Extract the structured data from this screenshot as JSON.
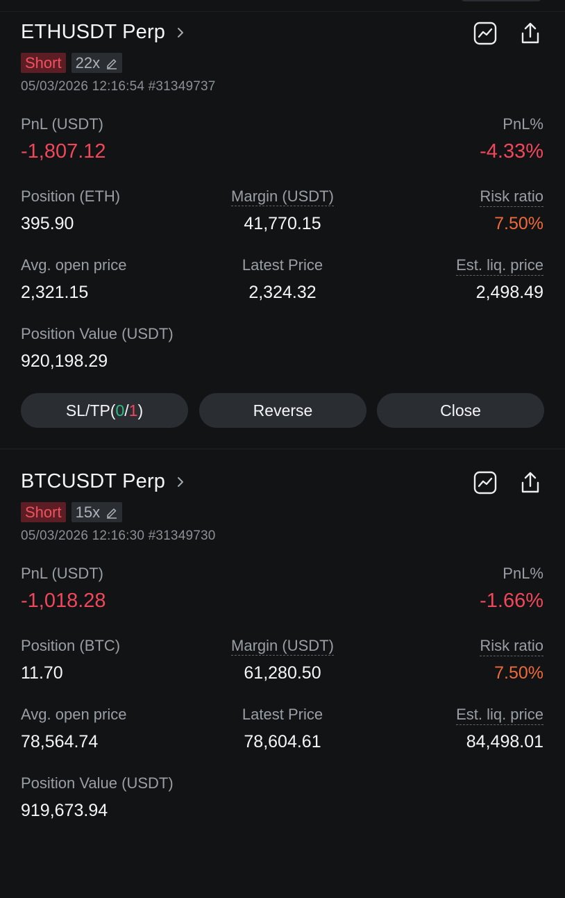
{
  "positions": [
    {
      "symbol": "ETHUSDT Perp",
      "side": "Short",
      "leverage": "22x",
      "opened": "05/03/2026 12:16:54",
      "order_id": "#31349737",
      "pnl_label": "PnL (USDT)",
      "pnl_value": "-1,807.12",
      "pnl_pct_label": "PnL%",
      "pnl_pct_value": "-4.33%",
      "position_label": "Position (ETH)",
      "position_value": "395.90",
      "margin_label": "Margin (USDT)",
      "margin_value": "41,770.15",
      "risk_label": "Risk ratio",
      "risk_value": "7.50%",
      "avg_open_label": "Avg. open price",
      "avg_open_value": "2,321.15",
      "latest_label": "Latest Price",
      "latest_value": "2,324.32",
      "liq_label": "Est. liq. price",
      "liq_value": "2,498.49",
      "pos_value_label": "Position Value (USDT)",
      "pos_value_value": "920,198.29",
      "sltp_prefix": "SL/TP(",
      "sltp_sl": "0",
      "sltp_sep": "/",
      "sltp_tp": "1",
      "sltp_suffix": ")",
      "reverse_label": "Reverse",
      "close_label": "Close"
    },
    {
      "symbol": "BTCUSDT Perp",
      "side": "Short",
      "leverage": "15x",
      "opened": "05/03/2026 12:16:30",
      "order_id": "#31349730",
      "pnl_label": "PnL (USDT)",
      "pnl_value": "-1,018.28",
      "pnl_pct_label": "PnL%",
      "pnl_pct_value": "-1.66%",
      "position_label": "Position (BTC)",
      "position_value": "11.70",
      "margin_label": "Margin (USDT)",
      "margin_value": "61,280.50",
      "risk_label": "Risk ratio",
      "risk_value": "7.50%",
      "avg_open_label": "Avg. open price",
      "avg_open_value": "78,564.74",
      "latest_label": "Latest Price",
      "latest_value": "78,604.61",
      "liq_label": "Est. liq. price",
      "liq_value": "84,498.01",
      "pos_value_label": "Position Value (USDT)",
      "pos_value_value": "919,673.94"
    }
  ],
  "icons": {
    "chevron": "chevron-right-icon",
    "chart": "line-chart-icon",
    "share": "share-icon",
    "edit": "pencil-icon"
  },
  "colors": {
    "background": "#121315",
    "loss_red": "#f0475a",
    "short_tag_bg": "#5c1e24",
    "risk_orange": "#ef6a3a",
    "tp_green": "#2ebd85",
    "button_bg": "#2a2d32"
  }
}
